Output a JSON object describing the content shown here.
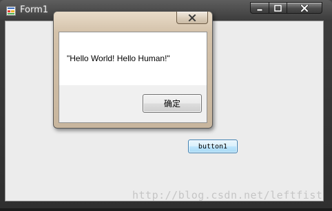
{
  "main_window": {
    "title": "Form1",
    "app_icon": "form-app-icon",
    "caption_buttons": [
      "minimize-icon",
      "maximize-icon",
      "close-icon"
    ],
    "button1_label": "button1"
  },
  "message_box": {
    "close_icon": "close-icon",
    "message": "\"Hello World! Hello Human!\"",
    "ok_label": "确定"
  },
  "watermark": "http://blog.csdn.net/leftfist",
  "colors": {
    "client_background": "#ececec",
    "button1_border": "#3c7fb1",
    "dialog_frame": "#d4c2aa"
  }
}
